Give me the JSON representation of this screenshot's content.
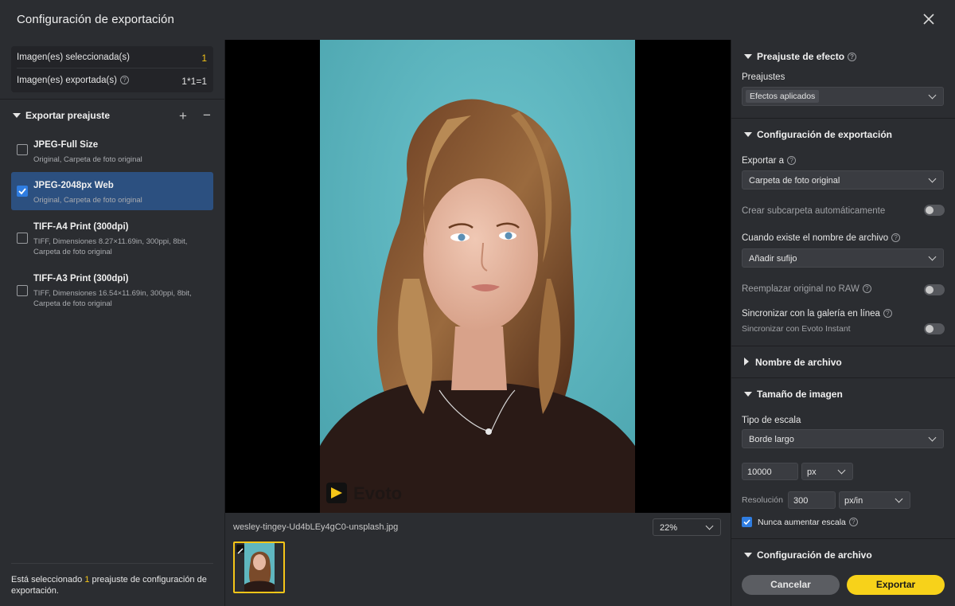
{
  "window": {
    "title": "Configuración de exportación"
  },
  "stats": {
    "selected_label": "Imagen(es) seleccionada(s)",
    "selected_value": "1",
    "exported_label": "Imagen(es) exportada(s)",
    "exported_value": "1*1=1"
  },
  "presets": {
    "header": "Exportar preajuste",
    "items": [
      {
        "name": "JPEG-Full Size",
        "desc": "Original, Carpeta de foto original",
        "checked": false
      },
      {
        "name": "JPEG-2048px Web",
        "desc": "Original, Carpeta de foto original",
        "checked": true
      },
      {
        "name": "TIFF-A4 Print (300dpi)",
        "desc": "TIFF, Dimensiones 8.27×11.69in, 300ppi, 8bit, Carpeta de foto original",
        "checked": false
      },
      {
        "name": "TIFF-A3 Print (300dpi)",
        "desc": "TIFF, Dimensiones 16.54×11.69in, 300ppi, 8bit, Carpeta de foto original",
        "checked": false
      }
    ],
    "footer_pre": "Está seleccionado ",
    "footer_count": "1",
    "footer_post": " preajuste de configuración de exportación."
  },
  "viewer": {
    "filename": "wesley-tingey-Ud4bLEy4gC0-unsplash.jpg",
    "zoom": "22%",
    "watermark": "Evoto"
  },
  "effect": {
    "header": "Preajuste de efecto",
    "presets_label": "Preajustes",
    "presets_value": "Efectos aplicados"
  },
  "export_config": {
    "header": "Configuración de exportación",
    "export_to_label": "Exportar a",
    "export_to_value": "Carpeta de foto original",
    "subfolder_label": "Crear subcarpeta automáticamente",
    "exists_label": "Cuando existe el nombre de archivo",
    "exists_value": "Añadir sufijo",
    "replace_label": "Reemplazar original no RAW",
    "sync_label": "Sincronizar con la galería en línea",
    "sync_sub": "Sincronizar con Evoto Instant"
  },
  "filename_section": {
    "header": "Nombre de archivo"
  },
  "image_size": {
    "header": "Tamaño de imagen",
    "scale_label": "Tipo de escala",
    "scale_value": "Borde largo",
    "size_value": "10000",
    "size_unit": "px",
    "resolution_label": "Resolución",
    "resolution_value": "300",
    "resolution_unit": "px/in",
    "never_upscale_label": "Nunca aumentar escala"
  },
  "file_config": {
    "header": "Configuración de archivo"
  },
  "actions": {
    "cancel": "Cancelar",
    "export": "Exportar"
  },
  "colors": {
    "accent": "#f5c518",
    "selection": "#2c5080",
    "checkbox": "#2f7de1"
  }
}
